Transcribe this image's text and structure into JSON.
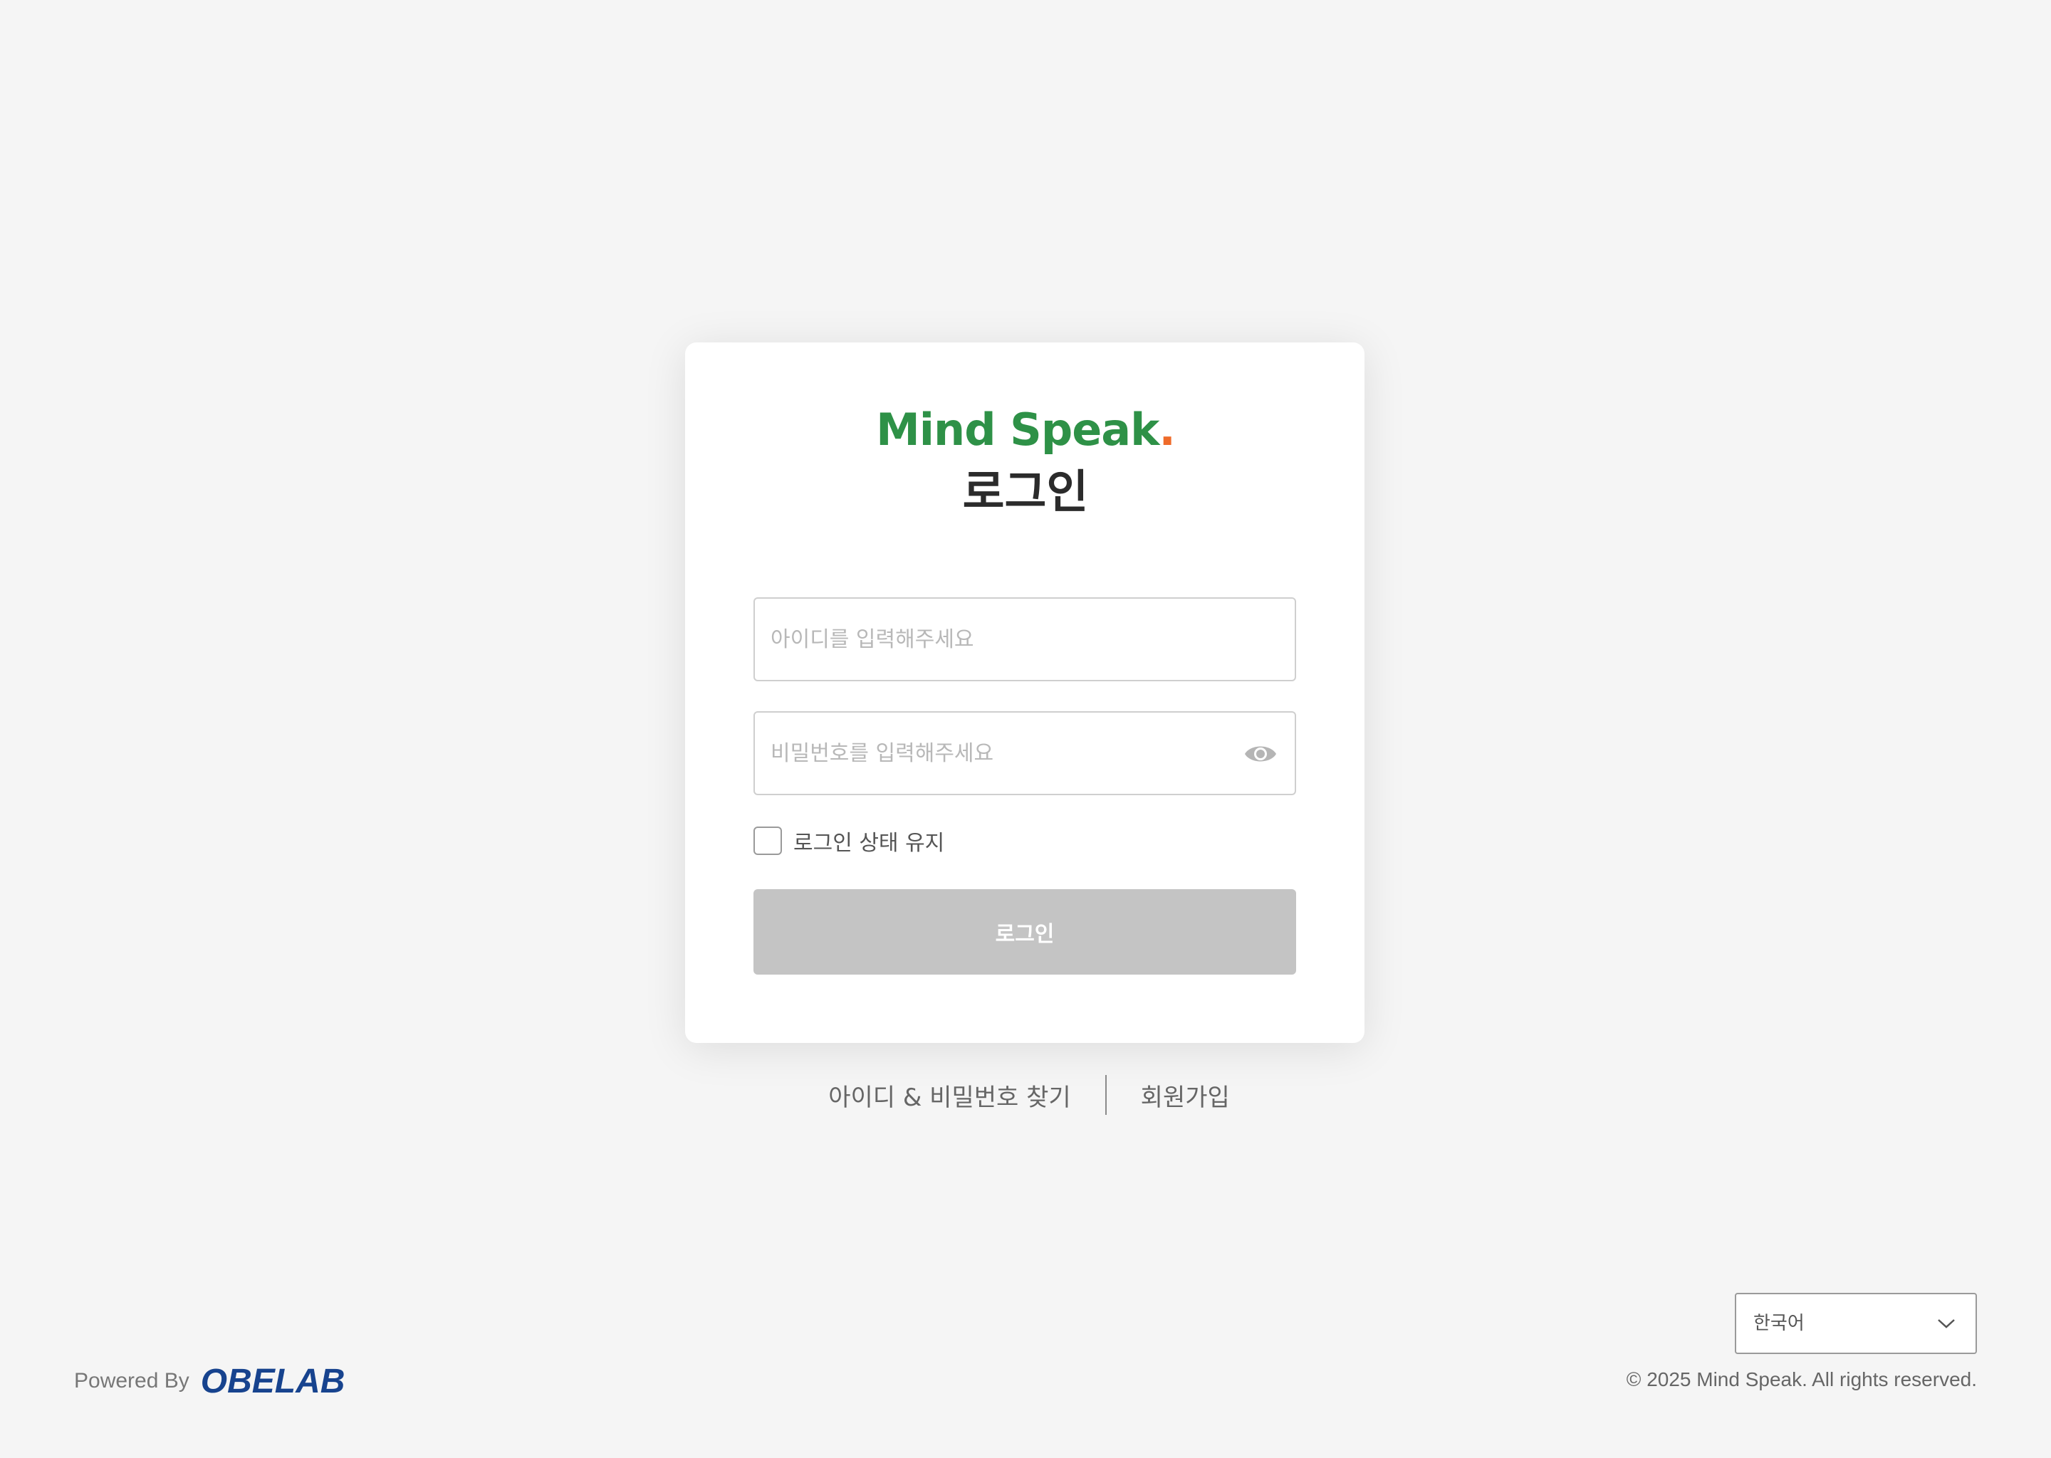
{
  "brand": {
    "logo_text": "Mind Speak",
    "logo_dot": ".",
    "logo_color": "#2e9147",
    "logo_dot_color": "#ef6b2a"
  },
  "login": {
    "title": "로그인",
    "id_placeholder": "아이디를 입력해주세요",
    "id_value": "",
    "password_placeholder": "비밀번호를 입력해주세요",
    "password_value": "",
    "password_toggle_icon": "eye-icon",
    "remember_label": "로그인 상태 유지",
    "remember_checked": false,
    "submit_label": "로그인",
    "submit_color": "#c4c4c4"
  },
  "links": {
    "find_account": "아이디 & 비밀번호 찾기",
    "signup": "회원가입"
  },
  "footer": {
    "powered_by": "Powered By",
    "company_logo": "OBELAB",
    "company_color": "#17438e",
    "language": {
      "selected": "한국어",
      "icon": "chevron-down-icon"
    },
    "copyright": "© 2025 Mind Speak. All rights reserved."
  }
}
